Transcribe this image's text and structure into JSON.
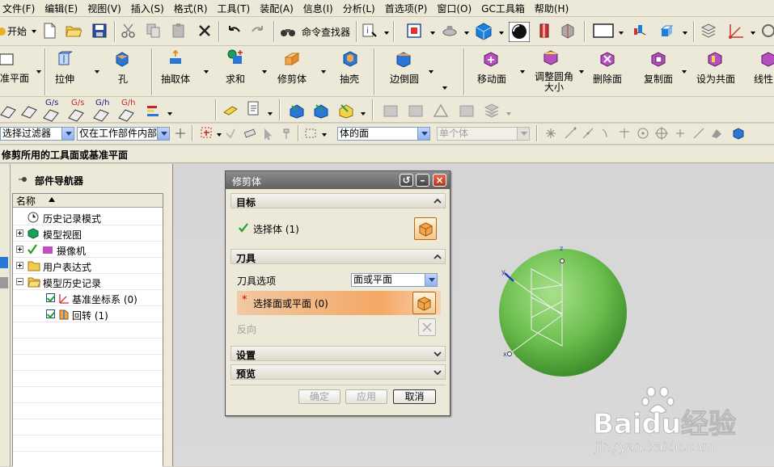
{
  "menu": [
    "文件(F)",
    "编辑(E)",
    "视图(V)",
    "插入(S)",
    "格式(R)",
    "工具(T)",
    "装配(A)",
    "信息(I)",
    "分析(L)",
    "首选项(P)",
    "窗口(O)",
    "GC工具箱",
    "帮助(H)"
  ],
  "toolbar1": {
    "start_label": "开始",
    "find_cmd_label": "命令查找器"
  },
  "toolbar2": {
    "items": [
      "准平面",
      "拉伸",
      "孔",
      "抽取体",
      "求和",
      "修剪体",
      "抽壳",
      "边倒圆",
      "移动面",
      "调整圆角大小",
      "删除面",
      "复制面",
      "设为共面",
      "线性"
    ]
  },
  "toolbar3": {
    "labels": [
      "G/s",
      "G/s",
      "G/h",
      "G/h"
    ]
  },
  "filterbar": {
    "type_filter": "选择过滤器",
    "scope": "仅在工作部件内部",
    "face_rule": "体的面",
    "single": "单个体"
  },
  "cue_line": "修剪所用的工具面或基准平面",
  "navigator": {
    "title": "部件导航器",
    "column_name": "名称",
    "rows": [
      {
        "label": "历史记录模式",
        "indent": 0
      },
      {
        "label": "模型视图",
        "indent": 0
      },
      {
        "label": "摄像机",
        "indent": 0
      },
      {
        "label": "用户表达式",
        "indent": 0
      },
      {
        "label": "模型历史记录",
        "indent": 0
      },
      {
        "label": "基准坐标系 (0)",
        "indent": 1
      },
      {
        "label": "回转 (1)",
        "indent": 1
      }
    ]
  },
  "dialog": {
    "title": "修剪体",
    "section_target": "目标",
    "select_body": "选择体 (1)",
    "section_tool": "刀具",
    "tool_option_label": "刀具选项",
    "tool_option_value": "面或平面",
    "select_face": "选择面或平面 (0)",
    "reverse": "反向",
    "section_settings": "设置",
    "section_preview": "预览",
    "ok": "确定",
    "apply": "应用",
    "cancel": "取消"
  },
  "watermark": {
    "brand": "Baidu经验",
    "url": "jingyan.baidu.com"
  },
  "colors": {
    "accent_orange": "#f0a050",
    "sphere_green": "#6cbf4e",
    "title_gray": "#6d6d6d"
  }
}
